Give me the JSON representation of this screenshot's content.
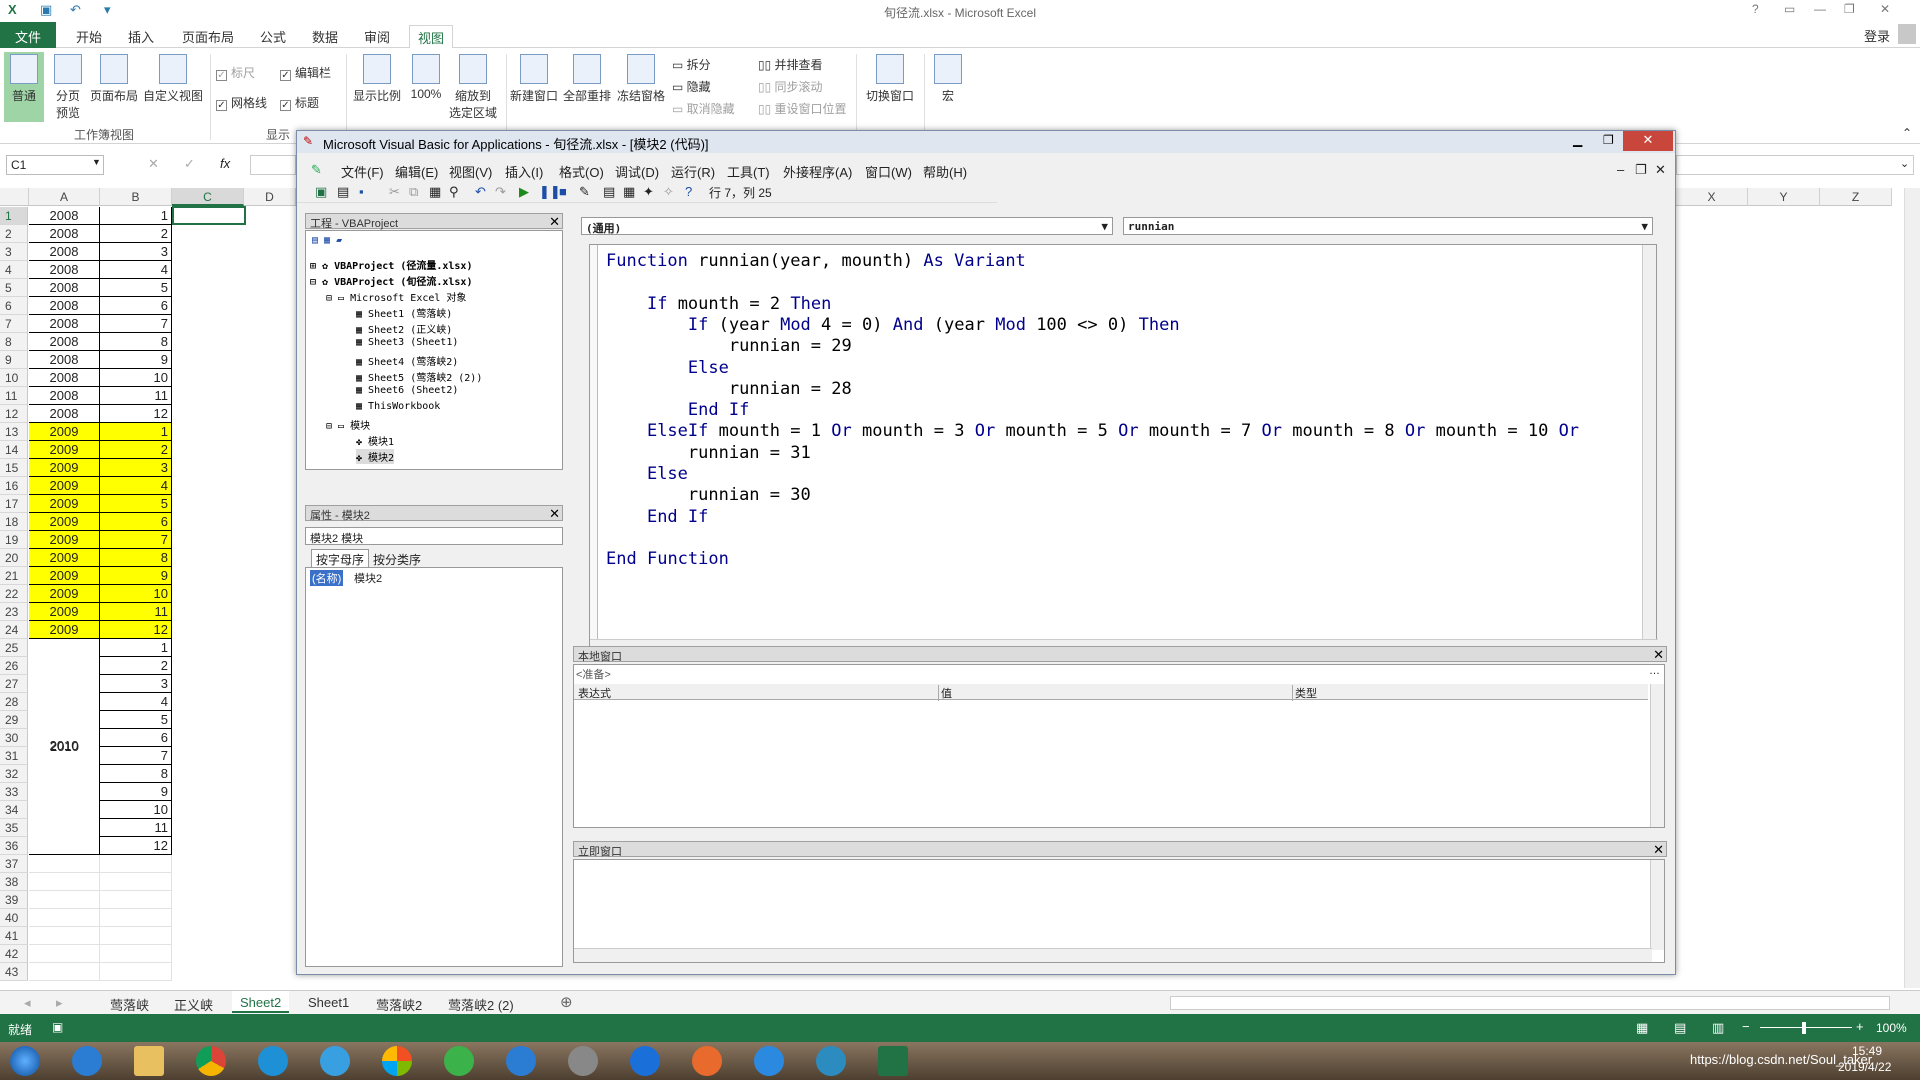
{
  "excel": {
    "title": "旬径流.xlsx - Microsoft Excel",
    "help": "?",
    "login": "登录",
    "tabs": [
      "文件",
      "开始",
      "插入",
      "页面布局",
      "公式",
      "数据",
      "审阅",
      "视图"
    ],
    "ribbon": {
      "normal": "普通",
      "pagebreak": "分页\n预览",
      "pagelayout": "页面布局",
      "customview": "自定义视图",
      "ruler": "标尺",
      "formulabar": "编辑栏",
      "gridlines": "网格线",
      "headings": "标题",
      "zoom": "显示比例",
      "zoom100": "100%",
      "zoomsel": "缩放到\n选定区域",
      "newwin": "新建窗口",
      "arrange": "全部重排",
      "freeze": "冻结窗格",
      "split": "拆分",
      "hide": "隐藏",
      "unhide": "取消隐藏",
      "sidebyside": "并排查看",
      "syncscroll": "同步滚动",
      "resetpos": "重设窗口位置",
      "switchwin": "切换窗口",
      "macro": "宏",
      "group_workbook": "工作簿视图",
      "group_show": "显示"
    },
    "namebox": "C1",
    "fx": "fx",
    "columns": [
      "A",
      "B",
      "C",
      "D"
    ],
    "right_columns": [
      "X",
      "Y",
      "Z"
    ],
    "rows": [
      {
        "a": "2008",
        "b": "1"
      },
      {
        "a": "2008",
        "b": "2"
      },
      {
        "a": "2008",
        "b": "3"
      },
      {
        "a": "2008",
        "b": "4"
      },
      {
        "a": "2008",
        "b": "5"
      },
      {
        "a": "2008",
        "b": "6"
      },
      {
        "a": "2008",
        "b": "7"
      },
      {
        "a": "2008",
        "b": "8"
      },
      {
        "a": "2008",
        "b": "9"
      },
      {
        "a": "2008",
        "b": "10"
      },
      {
        "a": "2008",
        "b": "11"
      },
      {
        "a": "2008",
        "b": "12"
      },
      {
        "a": "2009",
        "b": "1",
        "hl": true
      },
      {
        "a": "2009",
        "b": "2",
        "hl": true
      },
      {
        "a": "2009",
        "b": "3",
        "hl": true
      },
      {
        "a": "2009",
        "b": "4",
        "hl": true
      },
      {
        "a": "2009",
        "b": "5",
        "hl": true
      },
      {
        "a": "2009",
        "b": "6",
        "hl": true
      },
      {
        "a": "2009",
        "b": "7",
        "hl": true
      },
      {
        "a": "2009",
        "b": "8",
        "hl": true
      },
      {
        "a": "2009",
        "b": "9",
        "hl": true
      },
      {
        "a": "2009",
        "b": "10",
        "hl": true
      },
      {
        "a": "2009",
        "b": "11",
        "hl": true
      },
      {
        "a": "2009",
        "b": "12",
        "hl": true
      },
      {
        "a": "",
        "b": "1"
      },
      {
        "a": "",
        "b": "2"
      },
      {
        "a": "",
        "b": "3"
      },
      {
        "a": "",
        "b": "4"
      },
      {
        "a": "",
        "b": "5"
      },
      {
        "a": "2010",
        "b": "6"
      },
      {
        "a": "",
        "b": "7"
      },
      {
        "a": "",
        "b": "8"
      },
      {
        "a": "",
        "b": "9"
      },
      {
        "a": "",
        "b": "10"
      },
      {
        "a": "",
        "b": "11"
      },
      {
        "a": "",
        "b": "12"
      },
      {
        "a": "",
        "b": ""
      },
      {
        "a": "",
        "b": ""
      },
      {
        "a": "",
        "b": ""
      },
      {
        "a": "",
        "b": ""
      },
      {
        "a": "",
        "b": ""
      },
      {
        "a": "",
        "b": ""
      },
      {
        "a": "",
        "b": ""
      }
    ],
    "sheet_tabs": [
      "莺落峡",
      "正义峡",
      "Sheet2",
      "Sheet1",
      "莺落峡2",
      "莺落峡2 (2)"
    ],
    "active_sheet": "Sheet2",
    "status_ready": "就绪",
    "zoom_pct": "100%"
  },
  "vba": {
    "title": "Microsoft Visual Basic for Applications - 旬径流.xlsx - [模块2 (代码)]",
    "menu": [
      "文件(F)",
      "编辑(E)",
      "视图(V)",
      "插入(I)",
      "格式(O)",
      "调试(D)",
      "运行(R)",
      "工具(T)",
      "外接程序(A)",
      "窗口(W)",
      "帮助(H)"
    ],
    "position": "行 7，列 25",
    "project_title": "工程 - VBAProject",
    "tree": [
      "VBAProject (径流量.xlsx)",
      "VBAProject (旬径流.xlsx)",
      "Microsoft Excel 对象",
      "Sheet1 (莺落峡)",
      "Sheet2 (正义峡)",
      "Sheet3 (Sheet1)",
      "Sheet4 (莺落峡2)",
      "Sheet5 (莺落峡2 (2))",
      "Sheet6 (Sheet2)",
      "ThisWorkbook",
      "模块",
      "模块1",
      "模块2"
    ],
    "props_title": "属性 - 模块2",
    "props_combo": "模块2 模块",
    "props_tabs": [
      "按字母序",
      "按分类序"
    ],
    "props_name_key": "(名称)",
    "props_name_val": "模块2",
    "combo_general": "(通用)",
    "combo_proc": "runnian",
    "code": [
      "Function runnian(year, mounth) As Variant",
      "",
      "    If mounth = 2 Then",
      "        If (year Mod 4 = 0) And (year Mod 100 <> 0) Then",
      "            runnian = 29",
      "        Else",
      "            runnian = 28",
      "        End If",
      "    ElseIf mounth = 1 Or mounth = 3 Or mounth = 5 Or mounth = 7 Or mounth = 8 Or mounth = 10 Or",
      "        runnian = 31",
      "    Else",
      "        runnian = 30",
      "    End If",
      "",
      "End Function"
    ],
    "locals_title": "本地窗口",
    "locals_ready": "<准备>",
    "locals_cols": [
      "表达式",
      "值",
      "类型"
    ],
    "immediate_title": "立即窗口"
  },
  "taskbar": {
    "time": "15:49",
    "date": "2019/4/22",
    "watermark": "https://blog.csdn.net/Soul_taker"
  }
}
